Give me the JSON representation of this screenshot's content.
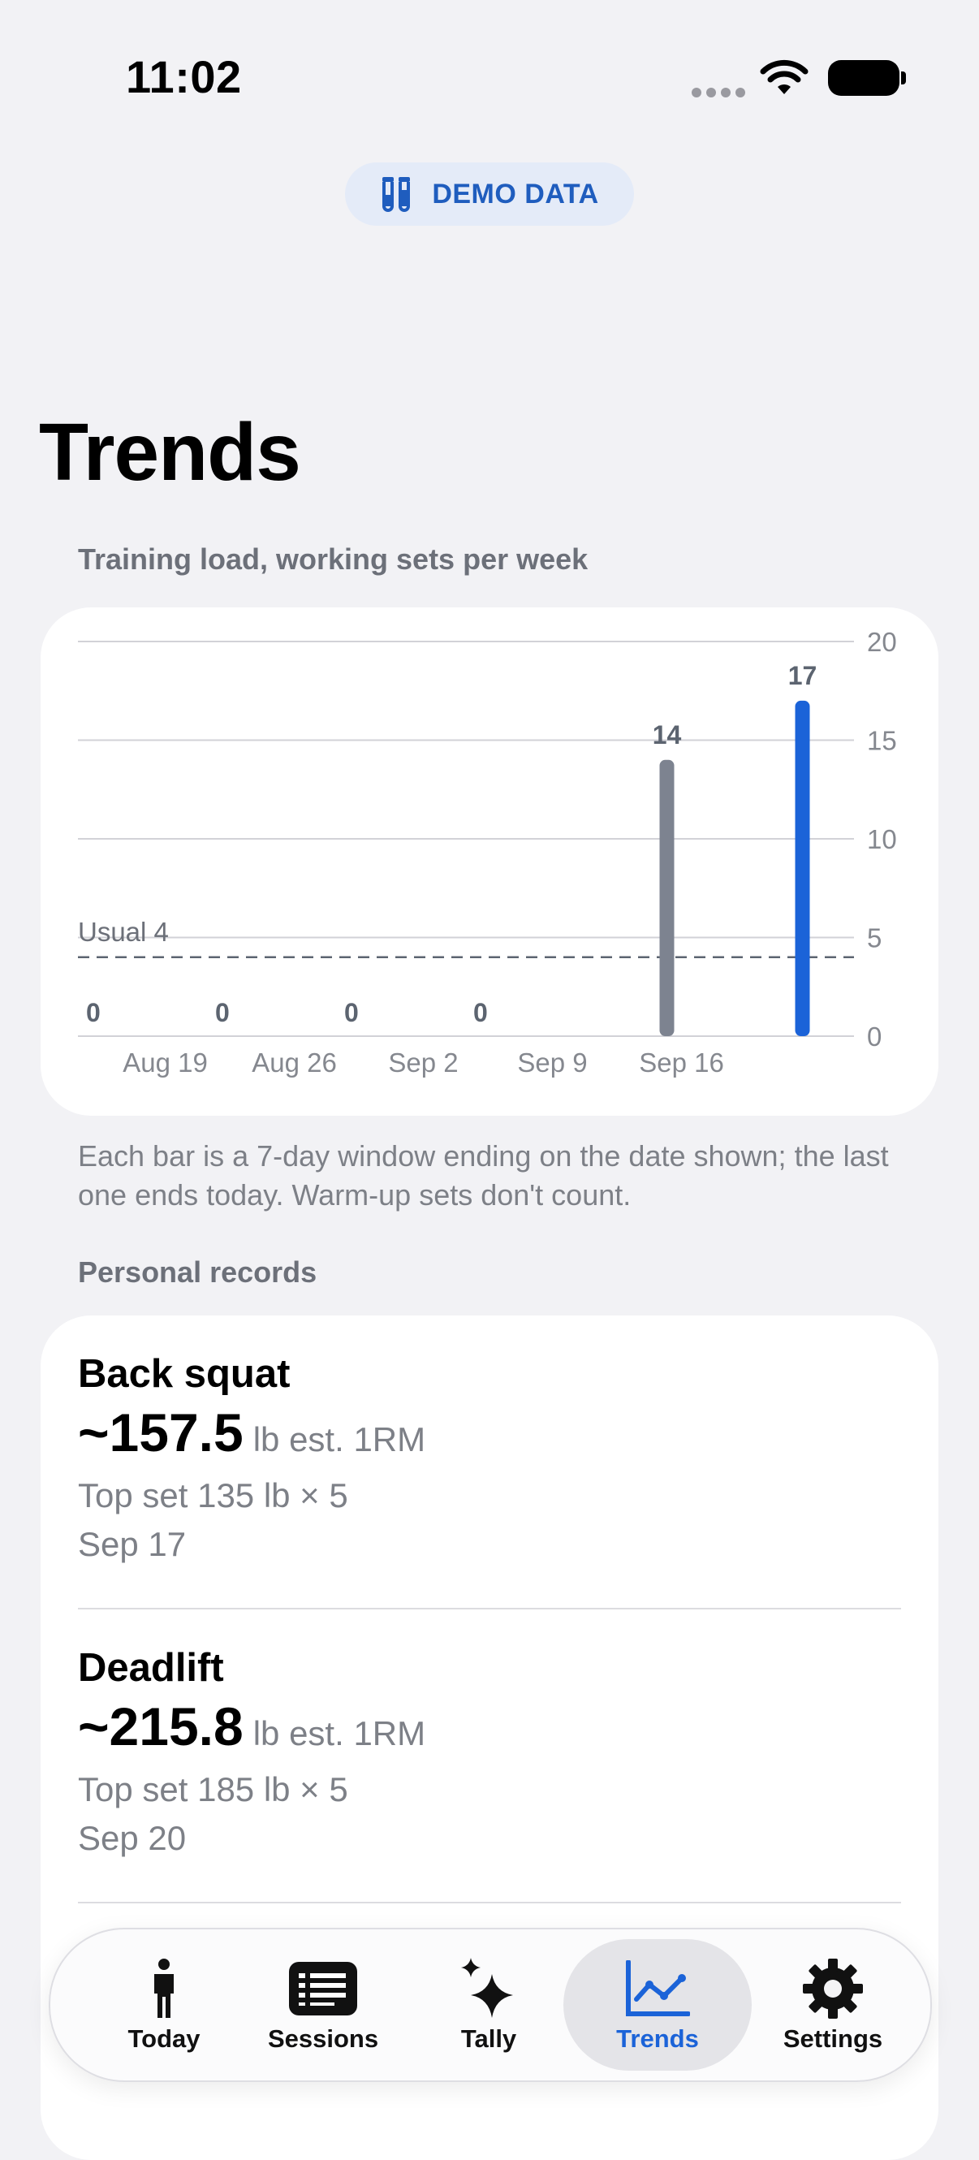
{
  "status_bar": {
    "time": "11:02"
  },
  "demo_badge": {
    "label": "DEMO DATA",
    "icon": "test-tubes-icon"
  },
  "page": {
    "title": "Trends"
  },
  "training_load": {
    "section_label": "Training load, working sets per week",
    "note": "Each bar is a 7-day window ending on the date shown; the last one ends today. Warm-up sets don't count."
  },
  "chart_data": {
    "type": "bar",
    "categories": [
      "Aug 19",
      "Aug 26",
      "Sep 2",
      "Sep 9",
      "Sep 16",
      ""
    ],
    "values": [
      0,
      0,
      0,
      0,
      14,
      17
    ],
    "data_labels": [
      "0",
      "0",
      "0",
      "0",
      "14",
      "17"
    ],
    "ylim": [
      0,
      20
    ],
    "yticks": [
      0,
      5,
      10,
      15,
      20
    ],
    "ytick_labels": [
      "0",
      "5",
      "10",
      "15",
      "20"
    ],
    "baseline": {
      "label": "Usual 4",
      "value": 4
    },
    "bar_colors": [
      "#7d8390",
      "#7d8390",
      "#7d8390",
      "#7d8390",
      "#7d8390",
      "#1b63d8"
    ],
    "grid": true,
    "y_axis_position": "right"
  },
  "records": {
    "section_label": "Personal records",
    "items": [
      {
        "name": "Back squat",
        "value": "~157.5",
        "unit": "lb est. 1RM",
        "top_set": "Top set 135 lb × 5",
        "date": "Sep 17"
      },
      {
        "name": "Deadlift",
        "value": "~215.8",
        "unit": "lb est. 1RM",
        "top_set": "Top set 185 lb × 5",
        "date": "Sep 20"
      }
    ]
  },
  "tabbar": {
    "tabs": [
      {
        "label": "Today",
        "icon": "person-standing-icon"
      },
      {
        "label": "Sessions",
        "icon": "list-card-icon"
      },
      {
        "label": "Tally",
        "icon": "sparkles-icon"
      },
      {
        "label": "Trends",
        "icon": "trend-chart-icon",
        "active": true
      },
      {
        "label": "Settings",
        "icon": "gear-icon"
      }
    ]
  },
  "colors": {
    "accent": "#1b63d8",
    "background": "#f2f2f5",
    "secondary_text": "#7d8087"
  }
}
